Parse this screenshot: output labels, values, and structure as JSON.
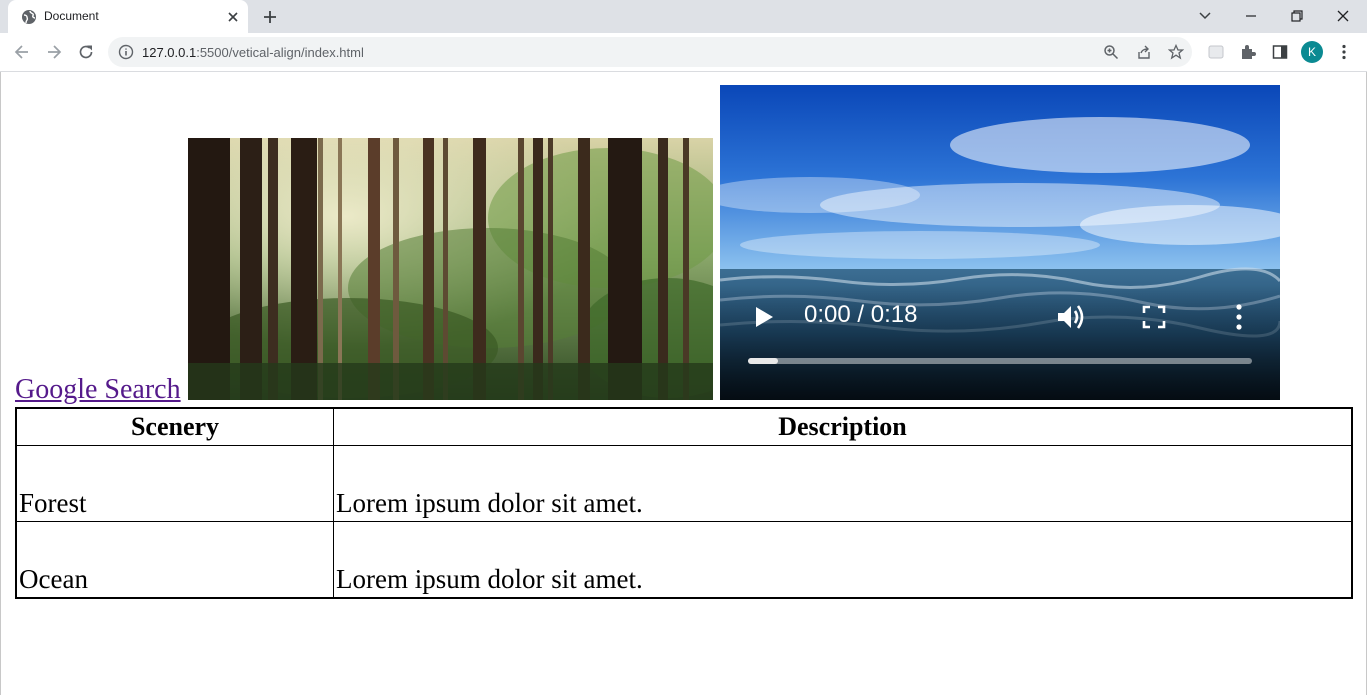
{
  "browser": {
    "tab_title": "Document",
    "url_host": "127.0.0.1",
    "url_rest": ":5500/vetical-align/index.html",
    "profile_initial": "K",
    "profile_color": "#0b8a92"
  },
  "page": {
    "link_text": "Google Search",
    "link_color": "#551a8b",
    "video": {
      "time": "0:00 / 0:18",
      "progress": 0.06
    },
    "table": {
      "headers": [
        "Scenery",
        "Description"
      ],
      "rows": [
        [
          "Forest",
          "Lorem ipsum dolor sit amet."
        ],
        [
          "Ocean",
          "Lorem ipsum dolor sit amet."
        ]
      ]
    }
  }
}
